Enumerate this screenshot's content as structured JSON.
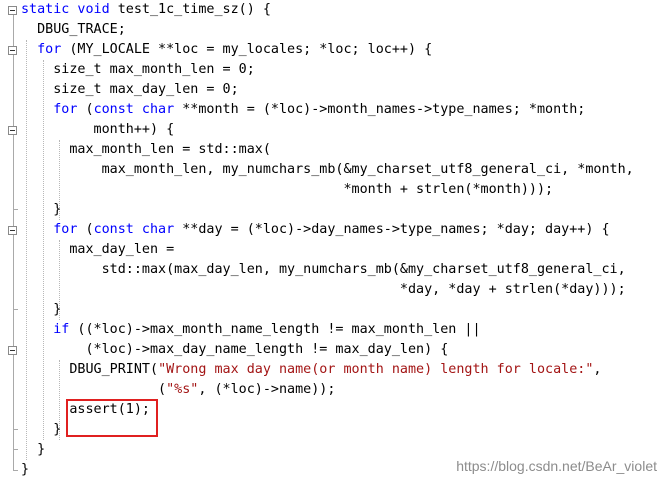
{
  "code_lines": [
    [
      [
        "kw",
        "static void "
      ],
      [
        "t",
        "test_1c_time_sz() {"
      ]
    ],
    [
      [
        "t",
        "  DBUG_TRACE;"
      ]
    ],
    [
      [
        "t",
        "  "
      ],
      [
        "kw",
        "for"
      ],
      [
        "t",
        " (MY_LOCALE **loc = my_locales; *loc; loc++) {"
      ]
    ],
    [
      [
        "t",
        "    size_t max_month_len = 0;"
      ]
    ],
    [
      [
        "t",
        "    size_t max_day_len = 0;"
      ]
    ],
    [
      [
        "t",
        "    "
      ],
      [
        "kw",
        "for"
      ],
      [
        "t",
        " ("
      ],
      [
        "kw",
        "const char"
      ],
      [
        "t",
        " **month = (*loc)->month_names->type_names; *month;"
      ]
    ],
    [
      [
        "t",
        "         month++) {"
      ]
    ],
    [
      [
        "t",
        "      max_month_len = std::max("
      ]
    ],
    [
      [
        "t",
        "          max_month_len, my_numchars_mb(&my_charset_utf8_general_ci, *month,"
      ]
    ],
    [
      [
        "t",
        "                                        *month + strlen(*month)));"
      ]
    ],
    [
      [
        "t",
        "    }"
      ]
    ],
    [
      [
        "t",
        "    "
      ],
      [
        "kw",
        "for"
      ],
      [
        "t",
        " ("
      ],
      [
        "kw",
        "const char"
      ],
      [
        "t",
        " **day = (*loc)->day_names->type_names; *day; day++) {"
      ]
    ],
    [
      [
        "t",
        "      max_day_len ="
      ]
    ],
    [
      [
        "t",
        "          std::max(max_day_len, my_numchars_mb(&my_charset_utf8_general_ci,"
      ]
    ],
    [
      [
        "t",
        "                                               *day, *day + strlen(*day)));"
      ]
    ],
    [
      [
        "t",
        "    }"
      ]
    ],
    [
      [
        "t",
        "    "
      ],
      [
        "kw",
        "if"
      ],
      [
        "t",
        " ((*loc)->max_month_name_length != max_month_len ||"
      ]
    ],
    [
      [
        "t",
        "        (*loc)->max_day_name_length != max_day_len) {"
      ]
    ],
    [
      [
        "t",
        "      DBUG_PRINT("
      ],
      [
        "str",
        "\"Wrong max day name(or month name) length for locale:\""
      ],
      [
        "t",
        ","
      ]
    ],
    [
      [
        "t",
        "                 ("
      ],
      [
        "str",
        "\"%s\""
      ],
      [
        "t",
        ", (*loc)->name));"
      ]
    ],
    [
      [
        "t",
        "      assert(1);"
      ]
    ],
    [
      [
        "t",
        "    }"
      ]
    ],
    [
      [
        "t",
        "  }"
      ]
    ],
    [
      [
        "t",
        "}"
      ]
    ]
  ],
  "watermark": "https://blog.csdn.net/BeAr_violet",
  "colors": {
    "keyword": "#0000ff",
    "string": "#a31515",
    "text": "#000000",
    "highlight_box": "#e02020"
  },
  "icons": [
    "fold-collapse-icon",
    "fold-guide-line"
  ]
}
